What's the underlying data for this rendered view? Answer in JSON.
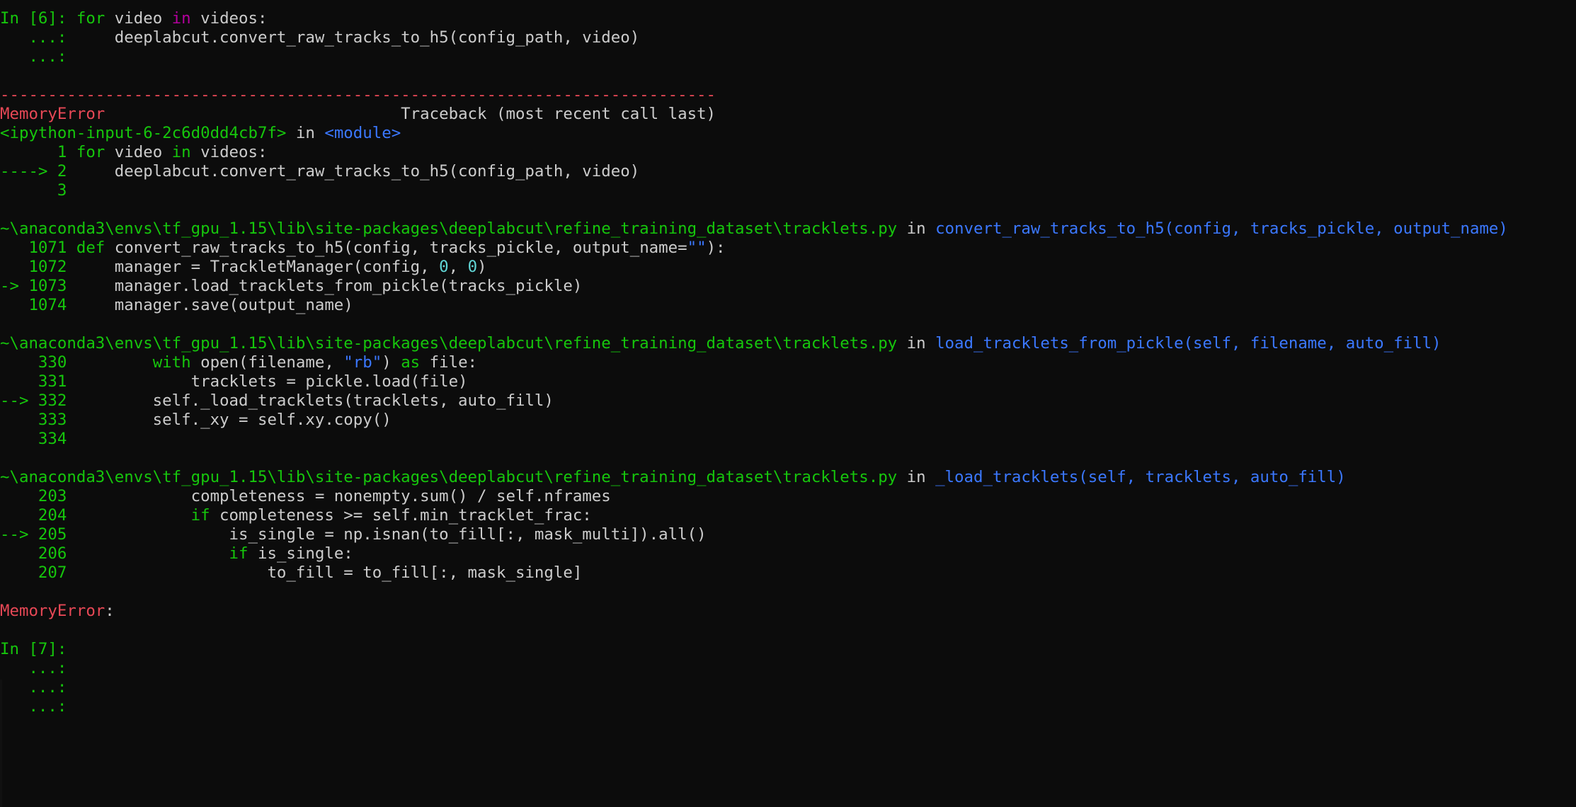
{
  "palette": {
    "background": "#0c0c0c",
    "text": "#cccccc",
    "green": "#16c60c",
    "red": "#e74856",
    "blue": "#3b78ff",
    "magenta": "#b4009e",
    "cyan": "#61d6d6"
  },
  "lines": [
    {
      "name": "input-prompt-line",
      "segments": [
        {
          "text": "In [6]: ",
          "color": "g"
        },
        {
          "text": "for",
          "color": "g"
        },
        {
          "text": " video ",
          "color": "w"
        },
        {
          "text": "in",
          "color": "m"
        },
        {
          "text": " videos:",
          "color": "w"
        }
      ]
    },
    {
      "name": "continuation-line",
      "segments": [
        {
          "text": "   ...: ",
          "color": "g"
        },
        {
          "text": "    deeplabcut.convert_raw_tracks_to_h5(config_path, video)",
          "color": "w"
        }
      ]
    },
    {
      "name": "continuation-line",
      "segments": [
        {
          "text": "   ...:",
          "color": "g"
        }
      ]
    },
    {
      "name": "blank-line",
      "segments": []
    },
    {
      "name": "traceback-separator",
      "segments": [
        {
          "text": "---------------------------------------------------------------------------",
          "color": "r"
        }
      ]
    },
    {
      "name": "error-header-line",
      "segments": [
        {
          "text": "MemoryError",
          "color": "r"
        },
        {
          "text": "                               Traceback (most recent call last)",
          "color": "w"
        }
      ]
    },
    {
      "name": "traceback-location",
      "segments": [
        {
          "text": "<ipython-input-6-2c6d0dd4cb7f>",
          "color": "g"
        },
        {
          "text": " in ",
          "color": "w"
        },
        {
          "text": "<module>",
          "color": "b"
        }
      ]
    },
    {
      "name": "traceback-code-line",
      "segments": [
        {
          "text": "      1 ",
          "color": "g"
        },
        {
          "text": "for",
          "color": "g"
        },
        {
          "text": " video ",
          "color": "w"
        },
        {
          "text": "in",
          "color": "g"
        },
        {
          "text": " videos:",
          "color": "w"
        }
      ]
    },
    {
      "name": "traceback-current-line",
      "segments": [
        {
          "text": "----> 2 ",
          "color": "g"
        },
        {
          "text": "    deeplabcut.convert_raw_tracks_to_h5(config_path, video)",
          "color": "w"
        }
      ]
    },
    {
      "name": "traceback-code-line",
      "segments": [
        {
          "text": "      3",
          "color": "g"
        }
      ]
    },
    {
      "name": "blank-line",
      "segments": []
    },
    {
      "name": "traceback-location",
      "segments": [
        {
          "text": "~\\anaconda3\\envs\\tf_gpu_1.15\\lib\\site-packages\\deeplabcut\\refine_training_dataset\\tracklets.py",
          "color": "g"
        },
        {
          "text": " in ",
          "color": "w"
        },
        {
          "text": "convert_raw_tracks_to_h5(config, tracks_pickle, output_name)",
          "color": "b"
        }
      ]
    },
    {
      "name": "traceback-code-line",
      "segments": [
        {
          "text": "   1071 ",
          "color": "g"
        },
        {
          "text": "def",
          "color": "g"
        },
        {
          "text": " convert_raw_tracks_to_h5(config, tracks_pickle, output_name=",
          "color": "w"
        },
        {
          "text": "\"\"",
          "color": "b"
        },
        {
          "text": "):",
          "color": "w"
        }
      ]
    },
    {
      "name": "traceback-code-line",
      "segments": [
        {
          "text": "   1072 ",
          "color": "g"
        },
        {
          "text": "    manager = TrackletManager(config, ",
          "color": "w"
        },
        {
          "text": "0",
          "color": "c"
        },
        {
          "text": ", ",
          "color": "w"
        },
        {
          "text": "0",
          "color": "c"
        },
        {
          "text": ")",
          "color": "w"
        }
      ]
    },
    {
      "name": "traceback-current-line",
      "segments": [
        {
          "text": "-> 1073 ",
          "color": "g"
        },
        {
          "text": "    manager.load_tracklets_from_pickle(tracks_pickle)",
          "color": "w"
        }
      ]
    },
    {
      "name": "traceback-code-line",
      "segments": [
        {
          "text": "   1074 ",
          "color": "g"
        },
        {
          "text": "    manager.save(output_name)",
          "color": "w"
        }
      ]
    },
    {
      "name": "blank-line",
      "segments": []
    },
    {
      "name": "traceback-location",
      "segments": [
        {
          "text": "~\\anaconda3\\envs\\tf_gpu_1.15\\lib\\site-packages\\deeplabcut\\refine_training_dataset\\tracklets.py",
          "color": "g"
        },
        {
          "text": " in ",
          "color": "w"
        },
        {
          "text": "load_tracklets_from_pickle(self, filename, auto_fill)",
          "color": "b"
        }
      ]
    },
    {
      "name": "traceback-code-line",
      "segments": [
        {
          "text": "    330 ",
          "color": "g"
        },
        {
          "text": "        ",
          "color": "w"
        },
        {
          "text": "with",
          "color": "g"
        },
        {
          "text": " open(filename, ",
          "color": "w"
        },
        {
          "text": "\"rb\"",
          "color": "b"
        },
        {
          "text": ") ",
          "color": "w"
        },
        {
          "text": "as",
          "color": "g"
        },
        {
          "text": " file:",
          "color": "w"
        }
      ]
    },
    {
      "name": "traceback-code-line",
      "segments": [
        {
          "text": "    331 ",
          "color": "g"
        },
        {
          "text": "            tracklets = pickle.load(file)",
          "color": "w"
        }
      ]
    },
    {
      "name": "traceback-current-line",
      "segments": [
        {
          "text": "--> 332 ",
          "color": "g"
        },
        {
          "text": "        self._load_tracklets(tracklets, auto_fill)",
          "color": "w"
        }
      ]
    },
    {
      "name": "traceback-code-line",
      "segments": [
        {
          "text": "    333 ",
          "color": "g"
        },
        {
          "text": "        self._xy = self.xy.copy()",
          "color": "w"
        }
      ]
    },
    {
      "name": "traceback-code-line",
      "segments": [
        {
          "text": "    334",
          "color": "g"
        }
      ]
    },
    {
      "name": "blank-line",
      "segments": []
    },
    {
      "name": "traceback-location",
      "segments": [
        {
          "text": "~\\anaconda3\\envs\\tf_gpu_1.15\\lib\\site-packages\\deeplabcut\\refine_training_dataset\\tracklets.py",
          "color": "g"
        },
        {
          "text": " in ",
          "color": "w"
        },
        {
          "text": "_load_tracklets(self, tracklets, auto_fill)",
          "color": "b"
        }
      ]
    },
    {
      "name": "traceback-code-line",
      "segments": [
        {
          "text": "    203 ",
          "color": "g"
        },
        {
          "text": "            completeness = nonempty.sum() / self.nframes",
          "color": "w"
        }
      ]
    },
    {
      "name": "traceback-code-line",
      "segments": [
        {
          "text": "    204 ",
          "color": "g"
        },
        {
          "text": "            ",
          "color": "w"
        },
        {
          "text": "if",
          "color": "g"
        },
        {
          "text": " completeness >= self.min_tracklet_frac:",
          "color": "w"
        }
      ]
    },
    {
      "name": "traceback-current-line",
      "segments": [
        {
          "text": "--> 205 ",
          "color": "g"
        },
        {
          "text": "                is_single = np.isnan(to_fill[:, mask_multi]).all()",
          "color": "w"
        }
      ]
    },
    {
      "name": "traceback-code-line",
      "segments": [
        {
          "text": "    206 ",
          "color": "g"
        },
        {
          "text": "                ",
          "color": "w"
        },
        {
          "text": "if",
          "color": "g"
        },
        {
          "text": " is_single:",
          "color": "w"
        }
      ]
    },
    {
      "name": "traceback-code-line",
      "segments": [
        {
          "text": "    207 ",
          "color": "g"
        },
        {
          "text": "                    to_fill = to_fill[:, mask_single]",
          "color": "w"
        }
      ]
    },
    {
      "name": "blank-line",
      "segments": []
    },
    {
      "name": "error-message-line",
      "segments": [
        {
          "text": "MemoryError",
          "color": "r"
        },
        {
          "text": ":",
          "color": "w"
        }
      ]
    },
    {
      "name": "blank-line",
      "segments": []
    },
    {
      "name": "input-prompt-line",
      "segments": [
        {
          "text": "In [7]:",
          "color": "g"
        }
      ]
    },
    {
      "name": "continuation-line",
      "segments": [
        {
          "text": "   ...:",
          "color": "g"
        }
      ]
    },
    {
      "name": "continuation-line",
      "segments": [
        {
          "text": "   ...:",
          "color": "g"
        }
      ]
    },
    {
      "name": "continuation-line",
      "segments": [
        {
          "text": "   ...:",
          "color": "g"
        }
      ]
    }
  ]
}
